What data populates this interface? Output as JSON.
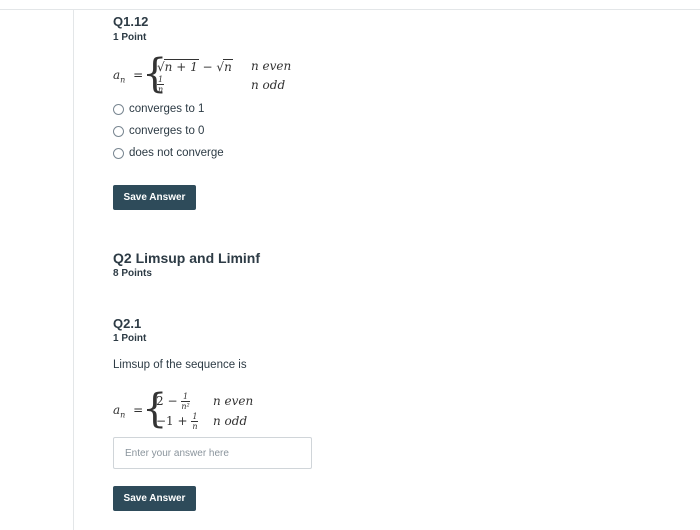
{
  "q1": {
    "title": "Q1.12",
    "points": "1 Point",
    "math": {
      "lhs": "a",
      "lhs_sub": "n",
      "eq": "=",
      "case1_a": "n + 1",
      "case1_minus": "−",
      "case1_b": "n",
      "case1_cond": "n even",
      "case2_num": "1",
      "case2_den": "n",
      "case2_cond": "n odd"
    },
    "options": [
      "converges to 1",
      "converges to 0",
      "does not converge"
    ],
    "save_label": "Save Answer"
  },
  "q2": {
    "title": "Q2 Limsup and Liminf",
    "points": "8 Points"
  },
  "q21": {
    "title": "Q2.1",
    "points": "1 Point",
    "prompt": "Limsup of the sequence is",
    "math": {
      "lhs": "a",
      "lhs_sub": "n",
      "eq": "=",
      "case1_prefix": "2 −",
      "case1_num": "1",
      "case1_den": "n²",
      "case1_cond": "n even",
      "case2_prefix": "−1 +",
      "case2_num": "1",
      "case2_den": "n",
      "case2_cond": "n odd"
    },
    "input_placeholder": "Enter your answer here",
    "input_value": "",
    "save_label": "Save Answer"
  }
}
